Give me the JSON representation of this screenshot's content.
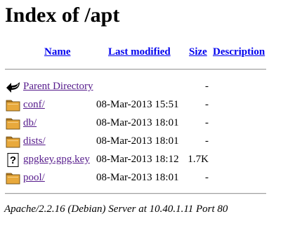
{
  "page": {
    "title": "Index of /apt"
  },
  "table": {
    "headers": {
      "name": "Name",
      "last_modified": "Last modified",
      "size": "Size",
      "description": "Description"
    },
    "rows": [
      {
        "icon": "back-arrow-icon",
        "name": "Parent Directory",
        "modified": "",
        "size": "-"
      },
      {
        "icon": "folder-icon",
        "name": "conf/",
        "modified": "08-Mar-2013 15:51",
        "size": "-"
      },
      {
        "icon": "folder-icon",
        "name": "db/",
        "modified": "08-Mar-2013 18:01",
        "size": "-"
      },
      {
        "icon": "folder-icon",
        "name": "dists/",
        "modified": "08-Mar-2013 18:01",
        "size": "-"
      },
      {
        "icon": "unknown-file-icon",
        "name": "gpgkey.gpg.key",
        "modified": "08-Mar-2013 18:12",
        "size": "1.7K"
      },
      {
        "icon": "folder-icon",
        "name": "pool/",
        "modified": "08-Mar-2013 18:01",
        "size": "-"
      }
    ]
  },
  "footer": {
    "address": "Apache/2.2.16 (Debian) Server at 10.40.1.11 Port 80"
  },
  "colors": {
    "link": "#0000ee",
    "visited": "#551a8b",
    "folder": "#e8a93c"
  }
}
